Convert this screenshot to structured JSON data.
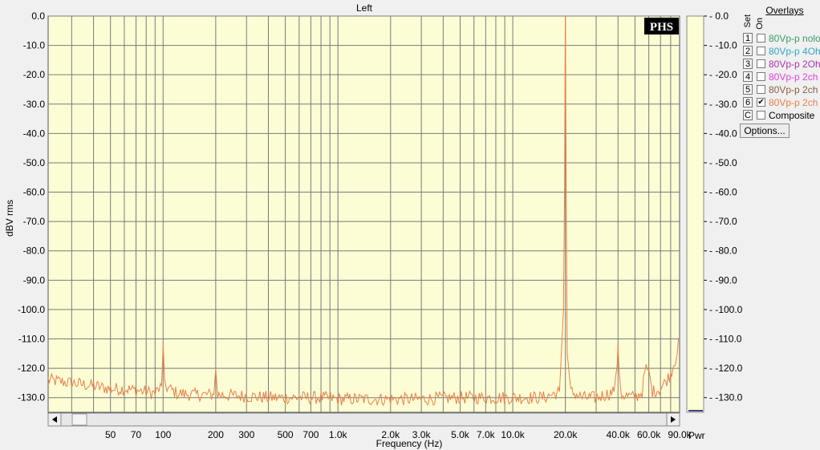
{
  "chart_data": {
    "type": "line",
    "title": "Left",
    "xlabel": "Frequency (Hz)",
    "ylabel": "dBV rms",
    "right_axis_label": "Pwr",
    "xscale": "log",
    "xlim": [
      22,
      90000
    ],
    "ylim": [
      -135,
      0
    ],
    "grid": true,
    "xticks": [
      50,
      70,
      100,
      200,
      300,
      500,
      700,
      1000,
      2000,
      3000,
      5000,
      7000,
      10000,
      20000,
      40000,
      60000,
      90000
    ],
    "xtick_labels": [
      "50",
      "70",
      "100",
      "200",
      "300",
      "500",
      "700",
      "1.0k",
      "2.0k",
      "3.0k",
      "5.0k",
      "7.0k",
      "10.0k",
      "20.0k",
      "40.0k",
      "60.0k",
      "90.0k"
    ],
    "yticks": [
      0,
      -10,
      -20,
      -30,
      -40,
      -50,
      -60,
      -70,
      -80,
      -90,
      -100,
      -110,
      -120,
      -130
    ],
    "ytick_labels": [
      "0.0",
      "-10.0",
      "-20.0",
      "-30.0",
      "-40.0",
      "-50.0",
      "-60.0",
      "-70.0",
      "-80.0",
      "-90.0",
      "-100.0",
      "-110.0",
      "-120.0",
      "-130.0"
    ],
    "series": [
      {
        "name": "80Vp-p 2ch",
        "color": "#e8804a",
        "x": [
          22,
          30,
          40,
          50,
          60,
          70,
          80,
          90,
          98,
          100,
          102,
          120,
          150,
          195,
          200,
          205,
          300,
          400,
          600,
          800,
          1000,
          1500,
          2000,
          3000,
          5000,
          8000,
          10000,
          15000,
          18500,
          19500,
          19800,
          19950,
          20000,
          20050,
          20200,
          20500,
          21500,
          25000,
          30000,
          38000,
          39500,
          40000,
          40500,
          42000,
          50000,
          55000,
          57000,
          58000,
          59000,
          60000,
          61000,
          63000,
          70000,
          80000,
          86000,
          90000
        ],
        "y": [
          -124,
          -125,
          -126,
          -127,
          -127,
          -127.5,
          -128,
          -128.5,
          -126,
          -112,
          -126,
          -128.5,
          -129,
          -129,
          -120,
          -129,
          -129.5,
          -130,
          -130,
          -130,
          -130.5,
          -130.5,
          -130.5,
          -130.5,
          -130,
          -130,
          -130,
          -130,
          -128,
          -100,
          -58,
          -10,
          0,
          -12,
          -56,
          -115,
          -128,
          -130,
          -130,
          -128,
          -118,
          -112,
          -122,
          -129,
          -130,
          -128,
          -121,
          -120,
          -122,
          -120,
          -124,
          -128,
          -127,
          -122,
          -116,
          -110
        ]
      }
    ]
  },
  "logo": {
    "text": "PHS"
  },
  "overlays": {
    "title": "Overlays",
    "set_label": "Set",
    "on_label": "On",
    "composite_label": "Composite",
    "options_label": "Options...",
    "items": [
      {
        "num": "1",
        "label": "80Vp-p nolo",
        "color": "#3a9a6a",
        "checked": false
      },
      {
        "num": "2",
        "label": "80Vp-p 4Oh",
        "color": "#32a8c0",
        "checked": false
      },
      {
        "num": "3",
        "label": "80Vp-p 2Oh",
        "color": "#b030b0",
        "checked": false
      },
      {
        "num": "4",
        "label": "80Vp-p 2ch",
        "color": "#e040e0",
        "checked": false
      },
      {
        "num": "5",
        "label": "80Vp-p 2ch",
        "color": "#8a6040",
        "checked": false
      },
      {
        "num": "6",
        "label": "80Vp-p 2ch",
        "color": "#e8804a",
        "checked": true
      },
      {
        "num": "C",
        "label": "Composite",
        "color": "#000000",
        "checked": false
      }
    ]
  }
}
